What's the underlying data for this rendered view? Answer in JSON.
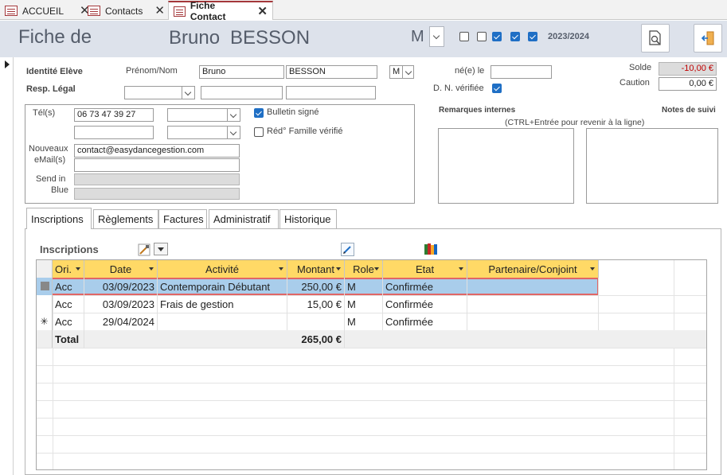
{
  "tabs": [
    {
      "label": "ACCUEIL"
    },
    {
      "label": "Contacts"
    },
    {
      "label": "Fiche Contact"
    }
  ],
  "header": {
    "title": "Fiche de",
    "first_name": "Bruno",
    "last_name": "BESSON",
    "gender": "M",
    "season": "2023/2024",
    "checkboxes": [
      false,
      false,
      true,
      true,
      true
    ]
  },
  "identity": {
    "section_label": "Identité Elève",
    "name_label": "Prénom/Nom",
    "first_name": "Bruno",
    "last_name": "BESSON",
    "gender": "M",
    "birth_label": "né(e) le",
    "birth_value": "",
    "dob_verified_label": "D. N. vérifiée",
    "dob_verified": true,
    "resp_label": "Resp. Légal"
  },
  "balance": {
    "solde_label": "Solde",
    "solde_value": "-10,00 €",
    "caution_label": "Caution",
    "caution_value": "0,00 €"
  },
  "contact": {
    "tel_label": "Tél(s)",
    "tel1": "06 73 47 39 27",
    "bulletin_label": "Bulletin signé",
    "bulletin_checked": true,
    "family_label": "Réd° Famille vérifié",
    "family_checked": false,
    "email_label_1": "Nouveaux",
    "email_label_2": "eMail(s)",
    "email1": "contact@easydancegestion.com",
    "sendin_label_1": "Send in",
    "sendin_label_2": "Blue"
  },
  "remarks": {
    "internal_label": "Remarques internes",
    "notes_label": "Notes de suivi",
    "hint": "(CTRL+Entrée pour revenir à la ligne)"
  },
  "subtabs": [
    {
      "label": "Inscriptions"
    },
    {
      "label": "Règlements"
    },
    {
      "label": "Factures"
    },
    {
      "label": "Administratif"
    },
    {
      "label": "Historique"
    }
  ],
  "inscriptions": {
    "title": "Inscriptions",
    "columns": [
      "Ori.",
      "Date",
      "Activité",
      "Montant",
      "Role",
      "Etat",
      "Partenaire/Conjoint"
    ],
    "rows": [
      {
        "ori": "Acc",
        "date": "03/09/2023",
        "activite": "Contemporain Débutant",
        "montant": "250,00 €",
        "role": "M",
        "etat": "Confirmée",
        "partenaire": ""
      },
      {
        "ori": "Acc",
        "date": "03/09/2023",
        "activite": "Frais de gestion",
        "montant": "15,00 €",
        "role": "M",
        "etat": "Confirmée",
        "partenaire": ""
      },
      {
        "ori": "Acc",
        "date": "29/04/2024",
        "activite": "",
        "montant": "",
        "role": "M",
        "etat": "Confirmée",
        "partenaire": ""
      }
    ],
    "new_row_marker": "✳",
    "total_label": "Total",
    "total_value": "265,00 €"
  },
  "colors": {
    "accent": "#a4373a",
    "header_bg": "#dde2eb",
    "grid_header": "#ffd966",
    "selected_row": "#a9cdeb",
    "checkbox_on": "#1f6fc5"
  }
}
